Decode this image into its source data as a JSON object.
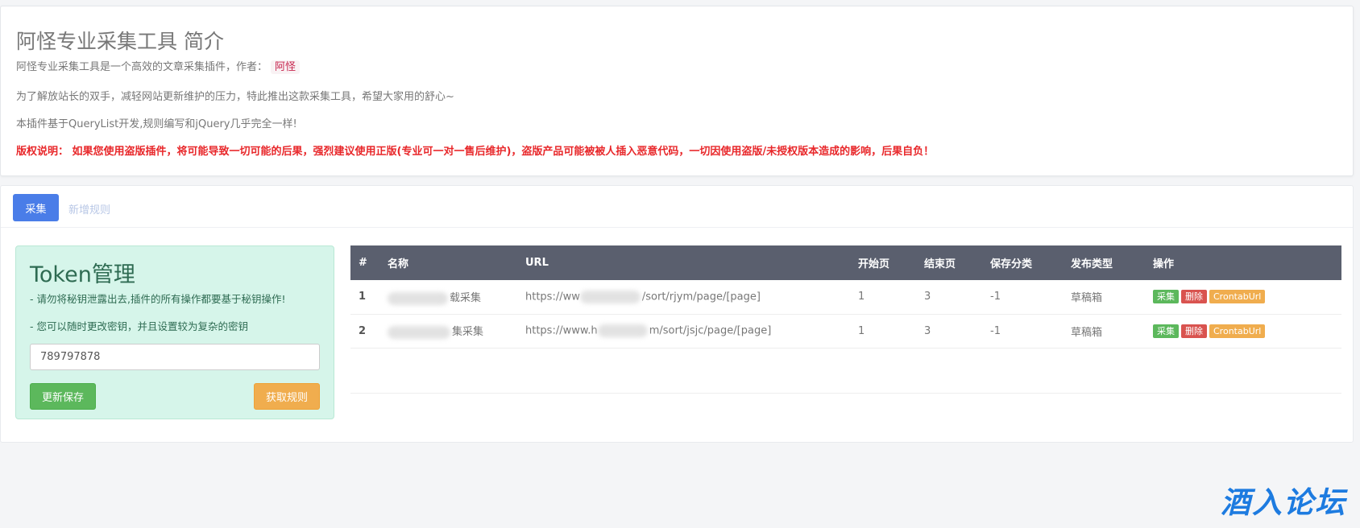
{
  "intro": {
    "title": "阿怪专业采集工具 简介",
    "line1_prefix": "阿怪专业采集工具是一个高效的文章采集插件，作者：",
    "author": "阿怪",
    "line2": "为了解放站长的双手，减轻网站更新维护的压力，特此推出这款采集工具，希望大家用的舒心~",
    "line3": "本插件基于QueryList开发,规则编写和jQuery几乎完全一样!",
    "copyright": "版权说明：  如果您使用盗版插件，将可能导致一切可能的后果，强烈建议使用正版(专业可一对一售后维护)，盗版产品可能被被人插入恶意代码，一切因使用盗版/未授权版本造成的影响，后果自负！"
  },
  "tabs": {
    "active": "采集",
    "add_rule": "新增规则"
  },
  "token": {
    "title": "Token管理",
    "note1": "- 请勿将秘钥泄露出去,插件的所有操作都要基于秘钥操作!",
    "note2": "- 您可以随时更改密钥，并且设置较为复杂的密钥",
    "value": "789797878",
    "save_label": "更新保存",
    "fetch_label": "获取规则"
  },
  "table": {
    "headers": [
      "#",
      "名称",
      "URL",
      "开始页",
      "结束页",
      "保存分类",
      "发布类型",
      "操作"
    ],
    "rows": [
      {
        "num": "1",
        "name_suffix": "载采集",
        "url_prefix": "https://ww",
        "url_suffix": "/sort/rjym/page/[page]",
        "start": "1",
        "end": "3",
        "category": "-1",
        "publish": "草稿箱",
        "act_collect": "采集",
        "act_delete": "删除",
        "act_cron": "CrontabUrl"
      },
      {
        "num": "2",
        "name_suffix": "集采集",
        "url_prefix": "https://www.h",
        "url_suffix": "m/sort/jsjc/page/[page]",
        "start": "1",
        "end": "3",
        "category": "-1",
        "publish": "草稿箱",
        "act_collect": "采集",
        "act_delete": "删除",
        "act_cron": "CrontabUrl"
      }
    ]
  },
  "watermark": "酒入论坛",
  "colors": {
    "primary": "#4a7de8",
    "success": "#5cb85c",
    "warning": "#f0ad4e",
    "danger": "#d9534f",
    "table_header": "#5a5f6e",
    "token_bg": "#d6f5ea",
    "copyright": "#e8272a"
  }
}
